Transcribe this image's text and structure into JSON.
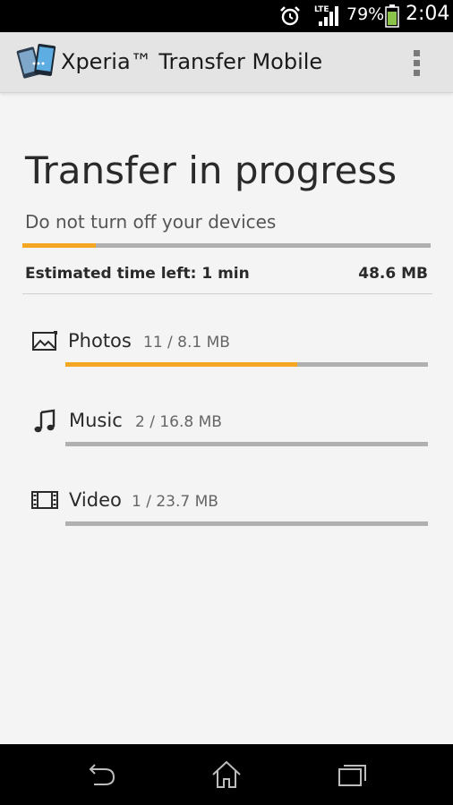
{
  "status_bar": {
    "network": "LTE",
    "battery_percent": "79%",
    "time": "2:04",
    "icons": [
      "alarm-icon",
      "signal-icon",
      "battery-icon"
    ]
  },
  "action_bar": {
    "title": "Xperia™ Transfer Mobile",
    "icons": [
      "app-logo-icon",
      "overflow-menu-icon"
    ]
  },
  "transfer": {
    "title": "Transfer in progress",
    "subtitle": "Do not turn off your devices",
    "overall_progress": 0.18,
    "estimated_time_left": "Estimated time left: 1 min",
    "total_size": "48.6 MB"
  },
  "categories": [
    {
      "label": "Photos",
      "count": "11 / 8.1 MB",
      "progress": 0.64,
      "icon": "photo-icon"
    },
    {
      "label": "Music",
      "count": "2 / 16.8 MB",
      "progress": 0,
      "icon": "music-note-icon"
    },
    {
      "label": "Video",
      "count": "1 / 23.7 MB",
      "progress": 0,
      "icon": "film-icon"
    }
  ],
  "nav_bar": {
    "icons": [
      "back-icon",
      "home-icon",
      "recent-apps-icon"
    ]
  },
  "colors": {
    "accent": "#f5a623",
    "track": "#b0b0b0",
    "background": "#f4f4f4",
    "action_bar": "#e4e4e4"
  }
}
